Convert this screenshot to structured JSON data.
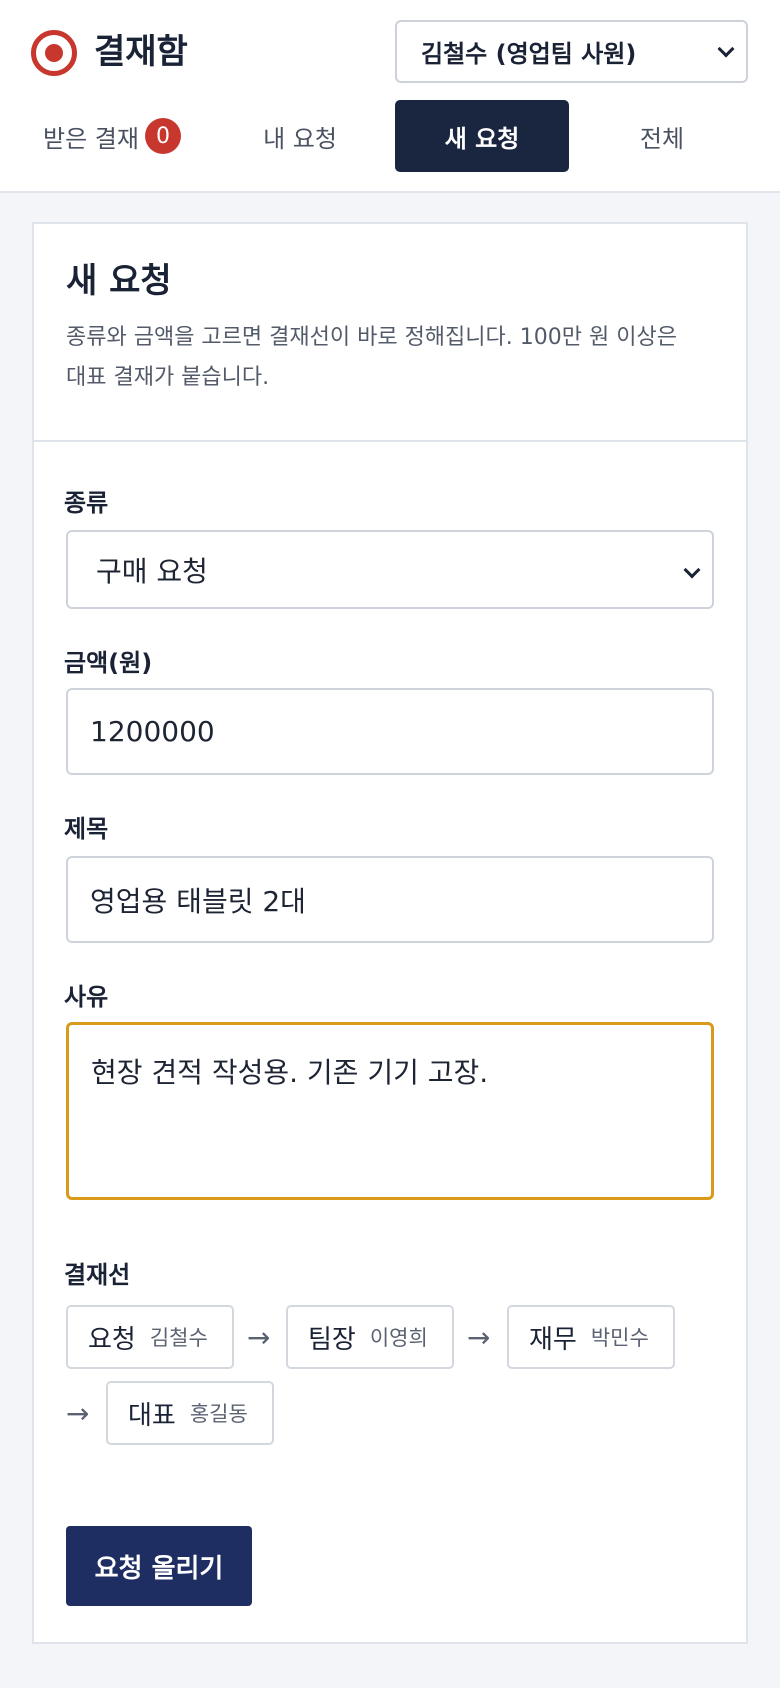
{
  "app": {
    "title": "결재함"
  },
  "user_select": {
    "value": "김철수 (영업팀 사원)"
  },
  "tabs": [
    {
      "label": "받은 결재",
      "badge": "0"
    },
    {
      "label": "내 요청"
    },
    {
      "label": "새 요청"
    },
    {
      "label": "전체"
    }
  ],
  "card": {
    "title": "새 요청",
    "description_line1": "종류와 금액을 고르면 결재선이 바로 정해집니다. 100만 원 이상은",
    "description_line2": "대표 결재가 붙습니다."
  },
  "form": {
    "type_label": "종류",
    "type_value": "구매 요청",
    "amount_label": "금액(원)",
    "amount_value": "1200000",
    "subject_label": "제목",
    "subject_value": "영업용 태블릿 2대",
    "reason_label": "사유",
    "reason_value": "현장 견적 작성용. 기존 기기 고장.",
    "approval_line_label": "결재선",
    "submit_label": "요청 올리기"
  },
  "approval_line": [
    {
      "role": "요청",
      "name": "김철수"
    },
    {
      "role": "팀장",
      "name": "이영희"
    },
    {
      "role": "재무",
      "name": "박민수"
    },
    {
      "role": "대표",
      "name": "홍길동"
    }
  ],
  "colors": {
    "accent_dark": "#1a2540",
    "primary_button": "#1f2e62",
    "brand_red": "#c8372d",
    "focus_border": "#d99a1a"
  }
}
